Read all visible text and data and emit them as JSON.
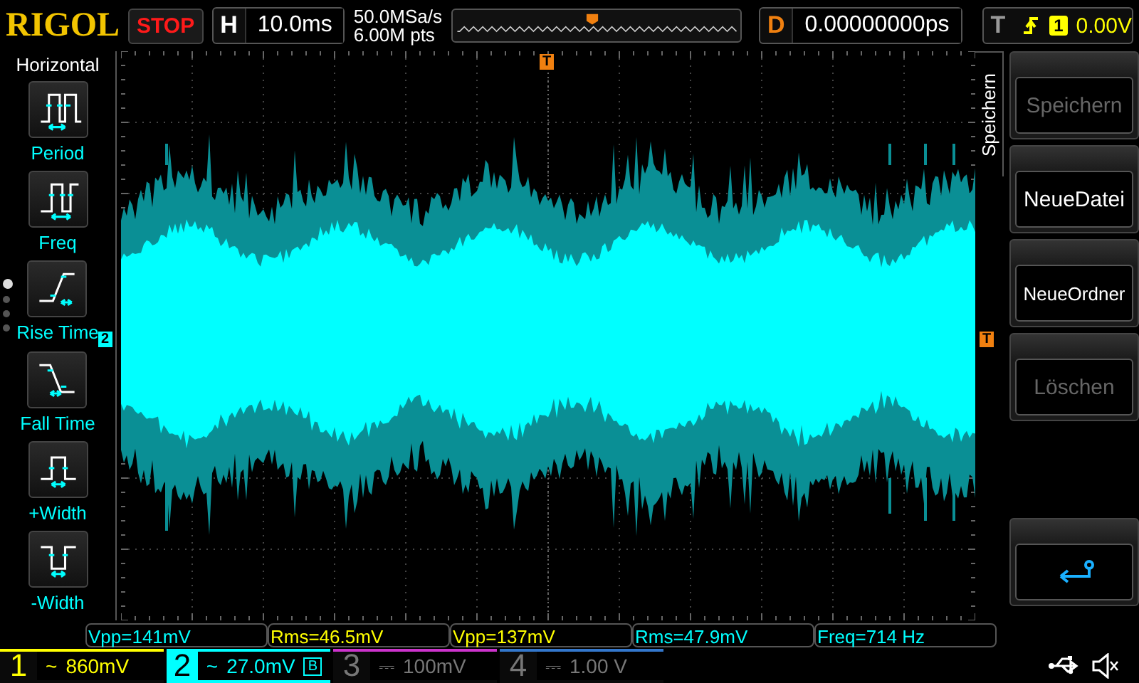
{
  "brand": "RIGOL",
  "run_state": {
    "label": "STOP",
    "kind": "stop"
  },
  "horizontal": {
    "label": "H",
    "value": "10.0ms"
  },
  "acquisition": {
    "sample_rate": "50.0MSa/s",
    "memory_depth": "6.00M pts"
  },
  "delay": {
    "label": "D",
    "value": "0.00000000ps"
  },
  "trigger": {
    "label": "T",
    "kind": "rising",
    "source": "1",
    "level": "0.00V"
  },
  "measure_menu": {
    "title": "Horizontal",
    "items": [
      {
        "label": "Period",
        "kind": "period"
      },
      {
        "label": "Freq",
        "kind": "freq"
      },
      {
        "label": "Rise Time",
        "kind": "rise"
      },
      {
        "label": "Fall Time",
        "kind": "fall"
      },
      {
        "label": "+Width",
        "kind": "pwidth"
      },
      {
        "label": "-Width",
        "kind": "nwidth"
      }
    ],
    "pages": [
      {
        "selected": true
      },
      {
        "selected": false
      },
      {
        "selected": false
      },
      {
        "selected": false
      }
    ]
  },
  "waveform": {
    "channel_marker": "2",
    "trigger_marker": "T",
    "trigger_level_marker": "T"
  },
  "softkey_menu": {
    "title": "Speichern",
    "items": [
      {
        "kind": "text",
        "label": "Speichern",
        "disabled": true
      },
      {
        "kind": "text",
        "label": "NeueDatei",
        "disabled": false
      },
      {
        "kind": "text",
        "label": "NeueOrdner",
        "disabled": false
      },
      {
        "kind": "text",
        "label": "Löschen",
        "disabled": true
      },
      {
        "kind": "return"
      }
    ]
  },
  "measurements": [
    {
      "text": "Vpp=141mV",
      "color": "#00ffff"
    },
    {
      "text": "Rms=46.5mV",
      "color": "#ffff00"
    },
    {
      "text": "Vpp=137mV",
      "color": "#ffff00"
    },
    {
      "text": "Rms=47.9mV",
      "color": "#00ffff"
    },
    {
      "text": "Freq=714 Hz",
      "color": "#00ffff"
    }
  ],
  "channels": [
    {
      "number": "1",
      "coupling": "~",
      "scale": "860mV",
      "on": true,
      "selected": false,
      "color": "#ffff00"
    },
    {
      "number": "2",
      "coupling": "~",
      "scale": "27.0mV",
      "on": true,
      "selected": true,
      "bw_limit": "B",
      "color": "#00ffff"
    },
    {
      "number": "3",
      "coupling": "⎓",
      "scale": "100mV",
      "on": false,
      "selected": false,
      "color": "#cc33cc"
    },
    {
      "number": "4",
      "coupling": "⎓",
      "scale": "1.00 V",
      "on": false,
      "selected": false,
      "color": "#3377cc"
    }
  ]
}
